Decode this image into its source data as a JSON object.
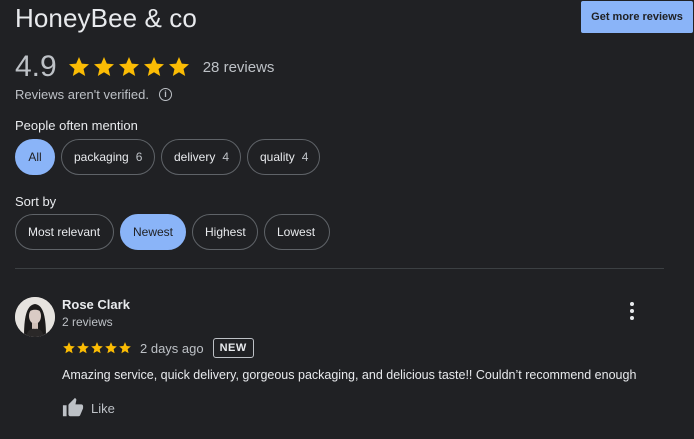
{
  "business": {
    "name": "HoneyBee & co",
    "get_more_label": "Get more reviews"
  },
  "summary": {
    "rating": "4.9",
    "stars": 5,
    "review_count": "28 reviews",
    "unverified_note": "Reviews aren't verified.",
    "info_icon": "info-icon"
  },
  "mentions": {
    "label": "People often mention",
    "chips": [
      {
        "label": "All",
        "count": "",
        "active": true
      },
      {
        "label": "packaging",
        "count": "6",
        "active": false
      },
      {
        "label": "delivery",
        "count": "4",
        "active": false
      },
      {
        "label": "quality",
        "count": "4",
        "active": false
      }
    ]
  },
  "sort": {
    "label": "Sort by",
    "options": [
      {
        "label": "Most relevant",
        "active": false
      },
      {
        "label": "Newest",
        "active": true
      },
      {
        "label": "Highest",
        "active": false
      },
      {
        "label": "Lowest",
        "active": false
      }
    ]
  },
  "review": {
    "author": "Rose Clark",
    "author_reviews": "2 reviews",
    "stars": 5,
    "date": "2 days ago",
    "badge": "NEW",
    "text": "Amazing service, quick delivery, gorgeous packaging, and delicious taste!! Couldn’t recommend enough",
    "like_label": "Like"
  },
  "colors": {
    "background": "#202124",
    "accent": "#8ab4f8",
    "star": "#fbbc04"
  }
}
